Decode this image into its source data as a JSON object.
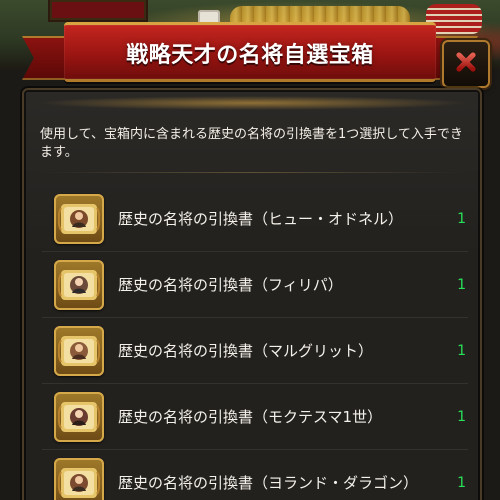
{
  "header": {
    "title": "戦略天才の名将自選宝箱"
  },
  "panel": {
    "description": "使用して、宝箱内に含まれる歴史の名将の引換書を1つ選択して入手できます。"
  },
  "items": [
    {
      "label": "歴史の名将の引換書（ヒュー・オドネル）",
      "count": "1"
    },
    {
      "label": "歴史の名将の引換書（フィリパ）",
      "count": "1"
    },
    {
      "label": "歴史の名将の引換書（マルグリット）",
      "count": "1"
    },
    {
      "label": "歴史の名将の引換書（モクテスマ1世）",
      "count": "1"
    },
    {
      "label": "歴史の名将の引換書（ヨランド・ダラゴン）",
      "count": "1"
    }
  ],
  "icons": {
    "close": "close-icon",
    "item": "scroll-portrait-icon"
  },
  "colors": {
    "banner_red": "#b81d18",
    "gold": "#d5a84a",
    "count_green": "#27e159"
  }
}
